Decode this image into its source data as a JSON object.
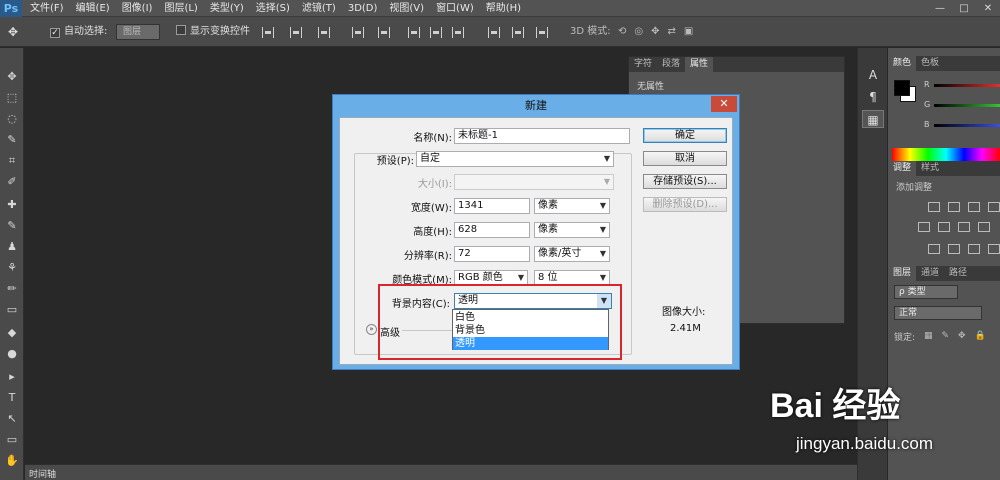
{
  "app": {
    "logo": "Ps"
  },
  "menubar": {
    "items": [
      "文件(F)",
      "编辑(E)",
      "图像(I)",
      "图层(L)",
      "类型(Y)",
      "选择(S)",
      "滤镜(T)",
      "3D(D)",
      "视图(V)",
      "窗口(W)",
      "帮助(H)"
    ],
    "window_controls": [
      "—",
      "□",
      "✕"
    ]
  },
  "options": {
    "tool_glyph": "✥",
    "auto_select_label": "自动选择:",
    "auto_select_value": "图层",
    "show_transform_label": "显示变换控件",
    "mode3d_label": "3D 模式:"
  },
  "tools": {
    "icons": [
      "✥",
      "⬚",
      "◌",
      "✎",
      "⌗",
      "✐",
      "✚",
      "✎",
      "♟",
      "⚘",
      "✏",
      "▭",
      "◆",
      "●",
      "▸",
      "T",
      "↖",
      "▭",
      "✋"
    ]
  },
  "timeline": {
    "tab": "时间轴"
  },
  "props_panel": {
    "tabs": [
      "字符",
      "段落",
      "属性"
    ],
    "active": "属性",
    "content": "无属性"
  },
  "mid_column": {
    "icons": [
      "A",
      "¶",
      "▦"
    ]
  },
  "color_panel": {
    "tabs": [
      "颜色",
      "色板"
    ],
    "active": "颜色",
    "labels": [
      "R",
      "G",
      "B"
    ],
    "colors": {
      "fg": "#000000",
      "bg": "#ffffff",
      "r": "#e0312e",
      "g": "#37c237",
      "b": "#3a4fe0"
    }
  },
  "adjust_panel": {
    "tabs": [
      "调整",
      "样式"
    ],
    "active": "调整",
    "add_label": "添加调整"
  },
  "layers_panel": {
    "tabs": [
      "图层",
      "通道",
      "路径"
    ],
    "active": "图层",
    "kind_label": "ρ 类型",
    "blend_mode": "正常",
    "lock_label": "锁定:"
  },
  "dialog": {
    "title": "新建",
    "close_label": "✕",
    "name_label": "名称(N):",
    "name_value": "未标题-1",
    "preset_label": "预设(P):",
    "preset_value": "自定",
    "size_label": "大小(I):",
    "width_label": "宽度(W):",
    "width_value": "1341",
    "width_unit": "像素",
    "height_label": "高度(H):",
    "height_value": "628",
    "height_unit": "像素",
    "resolution_label": "分辨率(R):",
    "resolution_value": "72",
    "resolution_unit": "像素/英寸",
    "colormode_label": "颜色模式(M):",
    "colormode_value": "RGB 颜色",
    "bitdepth_value": "8 位",
    "bg_label": "背景内容(C):",
    "bg_value": "透明",
    "bg_options": [
      "白色",
      "背景色",
      "透明"
    ],
    "bg_selected_index": 2,
    "advanced_label": "高级",
    "image_size_label": "图像大小:",
    "image_size_value": "2.41M",
    "buttons": {
      "ok": "确定",
      "cancel": "取消",
      "save_preset": "存储预设(S)...",
      "delete_preset": "删除预设(D)..."
    }
  },
  "watermark": {
    "brand": "Bai 经验",
    "url": "jingyan.baidu.com"
  }
}
